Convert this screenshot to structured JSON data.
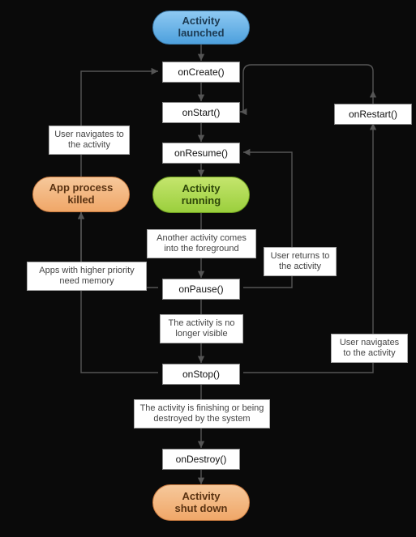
{
  "chart_data": {
    "type": "flowchart",
    "nodes": [
      {
        "id": "launched",
        "kind": "state",
        "label": "Activity\nlaunched"
      },
      {
        "id": "onCreate",
        "kind": "method",
        "label": "onCreate()"
      },
      {
        "id": "onStart",
        "kind": "method",
        "label": "onStart()"
      },
      {
        "id": "onResume",
        "kind": "method",
        "label": "onResume()"
      },
      {
        "id": "running",
        "kind": "state",
        "label": "Activity\nrunning"
      },
      {
        "id": "onPause",
        "kind": "method",
        "label": "onPause()"
      },
      {
        "id": "onStop",
        "kind": "method",
        "label": "onStop()"
      },
      {
        "id": "onDestroy",
        "kind": "method",
        "label": "onDestroy()"
      },
      {
        "id": "shutdown",
        "kind": "state",
        "label": "Activity\nshut down"
      },
      {
        "id": "killed",
        "kind": "state",
        "label": "App process\nkilled"
      },
      {
        "id": "onRestart",
        "kind": "method",
        "label": "onRestart()"
      }
    ],
    "edges": [
      {
        "from": "launched",
        "to": "onCreate"
      },
      {
        "from": "onCreate",
        "to": "onStart"
      },
      {
        "from": "onStart",
        "to": "onResume"
      },
      {
        "from": "onResume",
        "to": "running"
      },
      {
        "from": "running",
        "to": "onPause",
        "label": "Another activity comes\ninto the foreground"
      },
      {
        "from": "onPause",
        "to": "onStop",
        "label": "The activity is\nno longer visible"
      },
      {
        "from": "onStop",
        "to": "onDestroy",
        "label": "The activity is finishing or\nbeing destroyed by the system"
      },
      {
        "from": "onDestroy",
        "to": "shutdown"
      },
      {
        "from": "onPause",
        "to": "onResume",
        "label": "User returns\nto the activity"
      },
      {
        "from": "onStop",
        "to": "onRestart",
        "label": "User navigates\nto the activity"
      },
      {
        "from": "onRestart",
        "to": "onStart"
      },
      {
        "from": "onPause",
        "to": "killed",
        "label": "Apps with higher priority\nneed memory"
      },
      {
        "from": "onStop",
        "to": "killed"
      },
      {
        "from": "killed",
        "to": "onCreate",
        "label": "User navigates\nto the activity"
      }
    ]
  },
  "nodes": {
    "launched": "Activity\nlaunched",
    "onCreate": "onCreate()",
    "onStart": "onStart()",
    "onResume": "onResume()",
    "running": "Activity\nrunning",
    "onPause": "onPause()",
    "onStop": "onStop()",
    "onDestroy": "onDestroy()",
    "shutdown": "Activity\nshut down",
    "killed": "App process\nkilled",
    "onRestart": "onRestart()"
  },
  "labels": {
    "navToActivity": "User navigates\nto the activity",
    "fgActivity": "Another activity comes\ninto the foreground",
    "userReturns": "User returns\nto the activity",
    "higherPriority": "Apps with higher priority\nneed memory",
    "noLongerVisible": "The activity is\nno longer visible",
    "navToActivity2": "User navigates\nto the activity",
    "finishing": "The activity is finishing or\nbeing destroyed by the system"
  }
}
